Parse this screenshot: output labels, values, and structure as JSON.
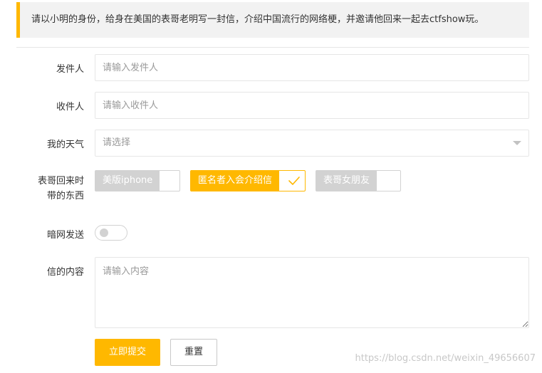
{
  "notice": {
    "text": "请以小明的身份，给身在美国的表哥老明写一封信，介绍中国流行的网络梗，并邀请他回来一起去ctfshow玩。"
  },
  "form": {
    "sender": {
      "label": "发件人",
      "placeholder": "请输入发件人",
      "value": ""
    },
    "receiver": {
      "label": "收件人",
      "placeholder": "请输入收件人",
      "value": ""
    },
    "weather": {
      "label": "我的天气",
      "placeholder": "请选择",
      "selected": ""
    },
    "gifts": {
      "label_line1": "表哥回来时",
      "label_line2": "带的东西",
      "options": [
        {
          "label": "美版iphone",
          "checked": false
        },
        {
          "label": "匿名者入会介绍信",
          "checked": true
        },
        {
          "label": "表哥女朋友",
          "checked": false
        }
      ]
    },
    "darknet": {
      "label": "暗网发送",
      "on": false
    },
    "content": {
      "label": "信的内容",
      "placeholder": "请输入内容",
      "value": ""
    }
  },
  "buttons": {
    "submit_label": "立即提交",
    "reset_label": "重置"
  },
  "watermark": {
    "text": "https://blog.csdn.net/weixin_49656607"
  },
  "colors": {
    "accent": "#ffb800",
    "unchecked": "#d2d2d2",
    "border": "#e6e6e6",
    "notice_bg": "#f2f2f2"
  }
}
